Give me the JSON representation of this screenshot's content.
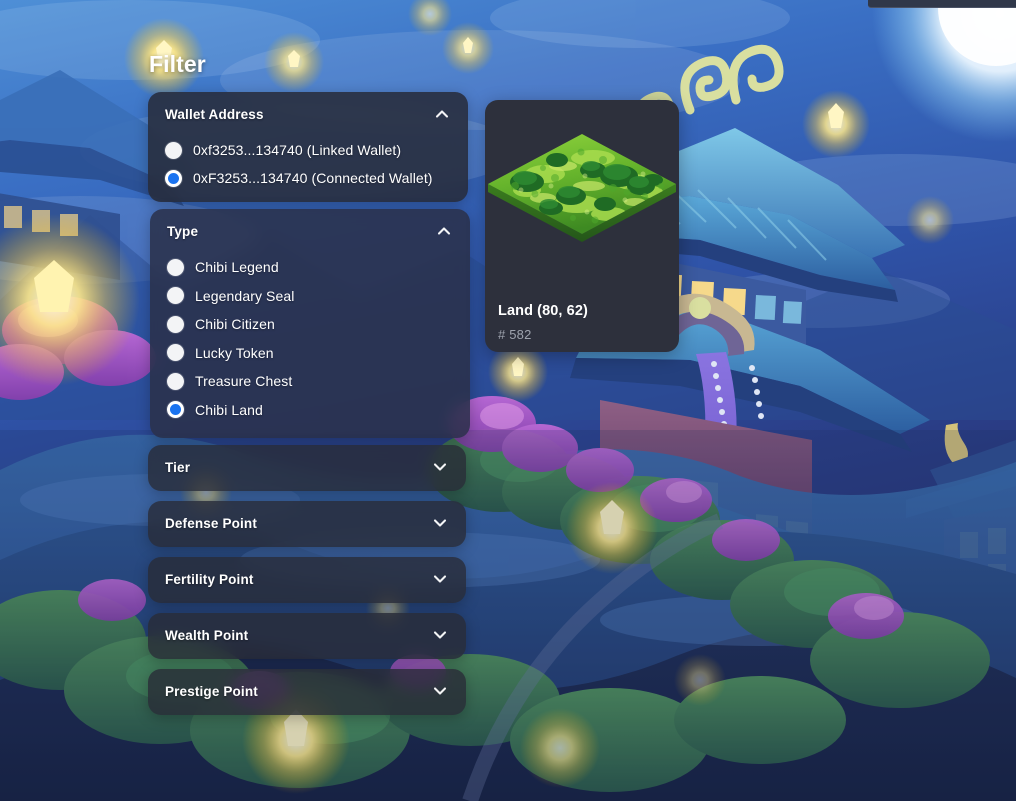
{
  "page": {
    "title": "Filter"
  },
  "filter": {
    "heading": "Filter",
    "sections": [
      {
        "id": "wallet-address",
        "label": "Wallet Address",
        "expanded": true,
        "chevron": "chevron-up-icon",
        "options": [
          {
            "label": "0xf3253...134740 (Linked Wallet)",
            "selected": false
          },
          {
            "label": "0xF3253...134740 (Connected Wallet)",
            "selected": true
          }
        ]
      },
      {
        "id": "type",
        "label": "Type",
        "expanded": true,
        "chevron": "chevron-up-icon",
        "options": [
          {
            "label": "Chibi Legend",
            "selected": false
          },
          {
            "label": "Legendary Seal",
            "selected": false
          },
          {
            "label": "Chibi Citizen",
            "selected": false
          },
          {
            "label": "Lucky Token",
            "selected": false
          },
          {
            "label": "Treasure Chest",
            "selected": false
          },
          {
            "label": "Chibi Land",
            "selected": true
          }
        ]
      },
      {
        "id": "tier",
        "label": "Tier",
        "expanded": false,
        "chevron": "chevron-down-icon"
      },
      {
        "id": "defense-point",
        "label": "Defense Point",
        "expanded": false,
        "chevron": "chevron-down-icon"
      },
      {
        "id": "fertility-point",
        "label": "Fertility Point",
        "expanded": false,
        "chevron": "chevron-down-icon"
      },
      {
        "id": "wealth-point",
        "label": "Wealth Point",
        "expanded": false,
        "chevron": "chevron-down-icon"
      },
      {
        "id": "prestige-point",
        "label": "Prestige Point",
        "expanded": false,
        "chevron": "chevron-down-icon"
      }
    ]
  },
  "results": {
    "cards": [
      {
        "name": "Land (80, 62)",
        "id": "# 582",
        "art": "isometric-land-tile"
      }
    ]
  },
  "colors": {
    "accent_blue": "#1a73f0",
    "panel_bg": "#272b3a",
    "card_bg": "#2d303c",
    "text_primary": "#ffffff",
    "text_muted": "#9ea3ae",
    "sky": "#2f5fb5",
    "land_green": "#62b42e"
  }
}
